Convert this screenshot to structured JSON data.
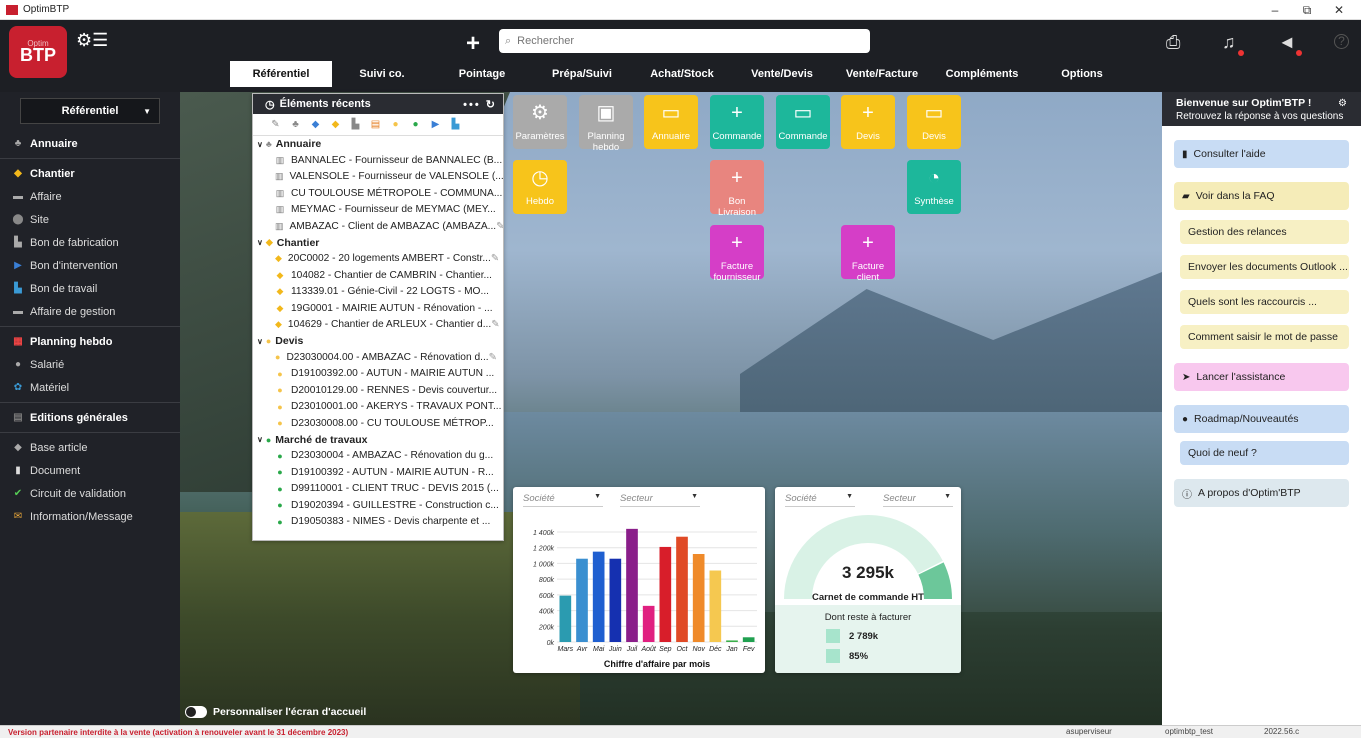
{
  "window": {
    "title": "OptimBTP",
    "min": "–",
    "restore": "⧉",
    "close": "✕"
  },
  "header": {
    "logo_small": "Optim",
    "logo": "BTP",
    "search_placeholder": "Rechercher"
  },
  "tabs": [
    {
      "label": "Référentiel",
      "active": true
    },
    {
      "label": "Suivi co."
    },
    {
      "label": "Pointage"
    },
    {
      "label": "Prépa/Suivi"
    },
    {
      "label": "Achat/Stock"
    },
    {
      "label": "Vente/Devis"
    },
    {
      "label": "Vente/Facture"
    },
    {
      "label": "Compléments"
    },
    {
      "label": "Options"
    }
  ],
  "sidebar": {
    "select": "Référentiel",
    "items": [
      {
        "label": "Annuaire",
        "head": true,
        "icon": "contacts-icon",
        "glyph": "♣",
        "color": "#aaa"
      },
      {
        "sep": true
      },
      {
        "label": "Chantier",
        "head": true,
        "icon": "chantier-icon",
        "glyph": "◆",
        "color": "#f2b81b"
      },
      {
        "label": "Affaire",
        "icon": "affaire-icon",
        "glyph": "▬",
        "color": "#aaa"
      },
      {
        "label": "Site",
        "icon": "location-icon",
        "glyph": "⬤",
        "color": "#888"
      },
      {
        "label": "Bon de fabrication",
        "icon": "factory-icon",
        "glyph": "▙",
        "color": "#aaa"
      },
      {
        "label": "Bon d'intervention",
        "icon": "intervention-icon",
        "glyph": "▶",
        "color": "#3a7fd5"
      },
      {
        "label": "Bon de travail",
        "icon": "work-icon",
        "glyph": "▙",
        "color": "#3a9ad5"
      },
      {
        "label": "Affaire de gestion",
        "icon": "gestion-icon",
        "glyph": "▬",
        "color": "#aaa"
      },
      {
        "sep": true
      },
      {
        "label": "Planning hebdo",
        "head": true,
        "icon": "calendar-icon",
        "glyph": "▦",
        "color": "#e44"
      },
      {
        "label": "Salarié",
        "icon": "person-icon",
        "glyph": "●",
        "color": "#aaa"
      },
      {
        "label": "Matériel",
        "icon": "gear-icon",
        "glyph": "✿",
        "color": "#3a9ad5"
      },
      {
        "sep": true
      },
      {
        "label": "Editions générales",
        "head": true,
        "icon": "print-icon",
        "glyph": "▤",
        "color": "#777"
      },
      {
        "sep": true
      },
      {
        "label": "Base article",
        "icon": "article-icon",
        "glyph": "◆",
        "color": "#aaa"
      },
      {
        "label": "Document",
        "icon": "document-icon",
        "glyph": "▮",
        "color": "#ddd"
      },
      {
        "label": "Circuit de validation",
        "icon": "check-icon",
        "glyph": "✔",
        "color": "#5c5"
      },
      {
        "label": "Information/Message",
        "icon": "message-icon",
        "glyph": "✉",
        "color": "#e6a53a"
      }
    ]
  },
  "recent": {
    "title": "Éléments récents",
    "filters": [
      "✎",
      "♣",
      "◆",
      "◆",
      "▙",
      "▤",
      "●",
      "●",
      "▶",
      "▙"
    ],
    "groups": [
      {
        "label": "Annuaire",
        "glyph": "♣",
        "color": "#888",
        "items": [
          {
            "text": "BANNALEC - Fournisseur de BANNALEC (B...",
            "glyph": "▥",
            "color": "#777",
            "pin": false
          },
          {
            "text": "VALENSOLE - Fournisseur de VALENSOLE (...",
            "glyph": "▥",
            "color": "#777",
            "pin": false
          },
          {
            "text": "CU TOULOUSE MÉTROPOLE - COMMUNA...",
            "glyph": "▥",
            "color": "#777",
            "pin": false
          },
          {
            "text": "MEYMAC - Fournisseur de MEYMAC (MEY...",
            "glyph": "▥",
            "color": "#777",
            "pin": false
          },
          {
            "text": "AMBAZAC - Client de AMBAZAC (AMBAZA...",
            "glyph": "▥",
            "color": "#777",
            "pin": true
          }
        ]
      },
      {
        "label": "Chantier",
        "glyph": "◆",
        "color": "#f2b81b",
        "items": [
          {
            "text": "20C0002 - 20 logements AMBERT - Constr...",
            "glyph": "◆",
            "color": "#f2b81b",
            "pin": true
          },
          {
            "text": "104082 - Chantier de CAMBRIN - Chantier...",
            "glyph": "◆",
            "color": "#f2b81b",
            "pin": false
          },
          {
            "text": "113339.01 - Génie-Civil - 22 LOGTS - MO...",
            "glyph": "◆",
            "color": "#f2b81b",
            "pin": false
          },
          {
            "text": "19G0001 - MAIRIE AUTUN - Rénovation - ...",
            "glyph": "◆",
            "color": "#f2b81b",
            "pin": false
          },
          {
            "text": "104629 - Chantier de ARLEUX - Chantier d...",
            "glyph": "◆",
            "color": "#f2b81b",
            "pin": true
          }
        ]
      },
      {
        "label": "Devis",
        "glyph": "●",
        "color": "#f5c44a",
        "items": [
          {
            "text": "D23030004.00 - AMBAZAC - Rénovation d...",
            "glyph": "●",
            "color": "#f5c44a",
            "pin": true
          },
          {
            "text": "D19100392.00 - AUTUN - MAIRIE AUTUN ...",
            "glyph": "●",
            "color": "#f5c44a",
            "pin": false
          },
          {
            "text": "D20010129.00 - RENNES - Devis couvertur...",
            "glyph": "●",
            "color": "#f5c44a",
            "pin": false
          },
          {
            "text": "D23010001.00 - AKERYS - TRAVAUX PONT...",
            "glyph": "●",
            "color": "#f5c44a",
            "pin": false
          },
          {
            "text": "D23030008.00 - CU TOULOUSE MÉTROP...",
            "glyph": "●",
            "color": "#f5c44a",
            "pin": false
          }
        ]
      },
      {
        "label": "Marché de travaux",
        "glyph": "●",
        "color": "#2aa84a",
        "items": [
          {
            "text": "D23030004 - AMBAZAC - Rénovation du g...",
            "glyph": "●",
            "color": "#2aa84a",
            "pin": false
          },
          {
            "text": "D19100392 - AUTUN - MAIRIE AUTUN - R...",
            "glyph": "●",
            "color": "#2aa84a",
            "pin": false
          },
          {
            "text": "D99110001 - CLIENT TRUC - DEVIS 2015 (...",
            "glyph": "●",
            "color": "#2aa84a",
            "pin": false
          },
          {
            "text": "D19020394 - GUILLESTRE - Construction c...",
            "glyph": "●",
            "color": "#2aa84a",
            "pin": false
          },
          {
            "text": "D19050383 - NIMES - Devis charpente et ...",
            "glyph": "●",
            "color": "#2aa84a",
            "pin": false
          }
        ]
      }
    ]
  },
  "tiles": [
    {
      "label": "Paramètres",
      "icon": "gear-icon",
      "glyph": "⚙",
      "cls": "t-gray"
    },
    {
      "label": "Planning hebdo",
      "icon": "calendar-icon",
      "glyph": "▣",
      "cls": "t-gray"
    },
    {
      "label": "Annuaire",
      "icon": "folder-icon",
      "glyph": "▭",
      "cls": "t-yel"
    },
    {
      "label": "Commande",
      "icon": "plus-icon",
      "glyph": "+",
      "cls": "t-teal"
    },
    {
      "label": "Commande",
      "icon": "folder-icon",
      "glyph": "▭",
      "cls": "t-teal"
    },
    {
      "label": "Devis",
      "icon": "plus-icon",
      "glyph": "+",
      "cls": "t-yel"
    },
    {
      "label": "Devis",
      "icon": "folder-icon",
      "glyph": "▭",
      "cls": "t-yel"
    },
    {
      "label": "Hebdo",
      "icon": "clock-icon",
      "glyph": "◷",
      "cls": "t-yel"
    },
    {
      "label": "Bon Livraison",
      "icon": "plus-icon",
      "glyph": "+",
      "cls": "t-pink"
    },
    {
      "label": "Synthèse",
      "icon": "pie-icon",
      "glyph": "◔",
      "cls": "t-teal"
    },
    {
      "label": "Facture fournisseur",
      "icon": "plus-icon",
      "glyph": "+",
      "cls": "t-mag"
    },
    {
      "label": "Facture client",
      "icon": "plus-icon",
      "glyph": "+",
      "cls": "t-mag"
    }
  ],
  "chart_data": {
    "type": "bar",
    "title": "Chiffre d'affaire par mois",
    "filters": [
      "Société",
      "Secteur"
    ],
    "categories": [
      "Mars",
      "Avr",
      "Mai",
      "Juin",
      "Juil",
      "Août",
      "Sep",
      "Oct",
      "Nov",
      "Déc",
      "Jan",
      "Fev"
    ],
    "values": [
      590000,
      1060000,
      1150000,
      1060000,
      1440000,
      460000,
      1210000,
      1340000,
      1120000,
      910000,
      20000,
      60000
    ],
    "colors": [
      "#2b9bb0",
      "#3a8fd0",
      "#1f5fd0",
      "#1530b0",
      "#8a1e8a",
      "#e02080",
      "#d81e2a",
      "#e04a26",
      "#ef8a2a",
      "#f5c850",
      "#3aae4a",
      "#20a050"
    ],
    "ylim": [
      0,
      1400000
    ],
    "yticks": [
      "0k",
      "200k",
      "400k",
      "600k",
      "800k",
      "1 000k",
      "1 200k",
      "1 400k"
    ]
  },
  "gauge": {
    "filters": [
      "Société",
      "Secteur"
    ],
    "value": "3 295k",
    "label": "Carnet de commande HT",
    "remaining_label": "Dont reste à facturer",
    "remaining_amount": "2 789k",
    "remaining_pct": "85%",
    "fill_fraction": 0.85
  },
  "right_panel": {
    "title": "Bienvenue sur Optim'BTP !",
    "subtitle": "Retrouvez la réponse à vos questions",
    "help": "Consulter l'aide",
    "faq": "Voir dans la FAQ",
    "faq_items": [
      "Gestion des relances",
      "Envoyer les documents Outlook ...",
      "Quels sont les raccourcis ...",
      "Comment saisir le mot de passe"
    ],
    "assist": "Lancer l'assistance",
    "roadmap": "Roadmap/Nouveautés",
    "news": "Quoi de neuf ?",
    "about": "A propos d'Optim'BTP"
  },
  "toggle_label": "Personnaliser l'écran d'accueil",
  "status": {
    "warning": "Version partenaire interdite à la vente (activation à renouveler avant le 31 décembre 2023)",
    "user": "asuperviseur",
    "db": "optimbtp_test",
    "version": "2022.56.c"
  }
}
